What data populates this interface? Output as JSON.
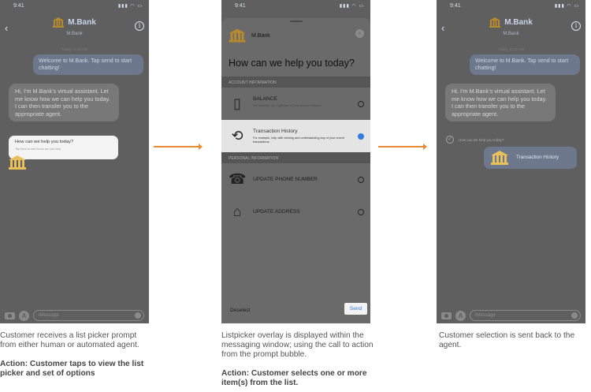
{
  "status": {
    "time": "9:41",
    "icons": "▮▮▮ ◠ ▭"
  },
  "header": {
    "brand": "M.Bank",
    "sub": "M.Bank"
  },
  "chat": {
    "timestamp": "Today, 11:38 AM",
    "welcome": "Welcome to M.Bank. Tap send to start chatting!",
    "assistant": "Hi, I'm M.Bank's virtual assistant. Let me know how we can help you today. I can then transfer you to the appropriate agent.",
    "prompt_title": "How can we help you today?",
    "prompt_sub": "Tap here to see forms we can help.",
    "message_placeholder": "iMessage"
  },
  "listpicker": {
    "brand": "M.Bank",
    "title": "How can we help you today?",
    "section_account": "ACCOUNT INFORMATION",
    "section_personal": "PERSONAL INFORMATION",
    "items": [
      {
        "title": "BALANCE",
        "sub": "For example, get a glimpse of your account balance."
      },
      {
        "title": "Transaction History",
        "sub": "For example, help with viewing and understanding any of your recent transactions."
      },
      {
        "title": "UPDATE PHONE NUMBER",
        "sub": ""
      },
      {
        "title": "UPDATE ADDRESS",
        "sub": ""
      }
    ],
    "deselect": "Deselect",
    "send": "Send"
  },
  "reply": {
    "check_text": "How can we help you today?",
    "selected": "Transaction History"
  },
  "captions": [
    {
      "text": "Customer receives a list picker prompt from either human or automated agent.",
      "action": "Action: Customer taps to view the list picker and set of options"
    },
    {
      "text": "Listpicker overlay is displayed within the messaging window; using the call to action from the prompt bubble.",
      "action": "Action: Customer selects one or more item(s) from the list."
    },
    {
      "text": "Customer selection is sent back to the agent.",
      "action": ""
    }
  ],
  "colors": {
    "arrow": "#e98a35",
    "accent_blue": "#2f7de0",
    "gold": "#e8c15a"
  }
}
